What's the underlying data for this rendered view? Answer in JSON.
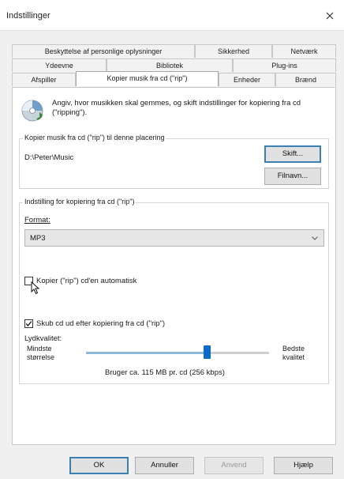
{
  "window": {
    "title": "Indstillinger"
  },
  "tabs": {
    "row1": [
      "Beskyttelse af personlige oplysninger",
      "Sikkerhed",
      "Netværk"
    ],
    "row2": [
      "Ydeevne",
      "Bibliotek",
      "Plug-ins"
    ],
    "row3": [
      "Afspiller",
      "Kopier musik fra cd (\"rip\")",
      "Enheder",
      "Brænd"
    ]
  },
  "intro": "Angiv, hvor musikken skal gemmes, og skift indstillinger for kopiering fra cd (\"ripping\").",
  "location_group": {
    "label": "Kopier musik fra cd (\"rip\") til denne placering",
    "path": "D:\\Peter\\Music",
    "change_button": "Skift...",
    "filename_button": "Filnavn..."
  },
  "rip_settings": {
    "label": "Indstilling for kopiering fra cd (\"rip\")",
    "format_label": "Format:",
    "format_value": "MP3",
    "auto_rip_label": "Kopier (\"rip\") cd'en automatisk",
    "auto_rip_checked": false,
    "eject_label": "Skub cd ud efter kopiering fra cd (\"rip\")",
    "eject_checked": true,
    "quality_label": "Lydkvalitet:",
    "min_label": "Mindste\nstørrelse",
    "max_label": "Bedste\nkvalitet",
    "quality_level": 0.67,
    "usage_text": "Bruger ca. 115 MB pr. cd (256 kbps)"
  },
  "buttons": {
    "ok": "OK",
    "cancel": "Annuller",
    "apply": "Anvend",
    "help": "Hjælp"
  }
}
